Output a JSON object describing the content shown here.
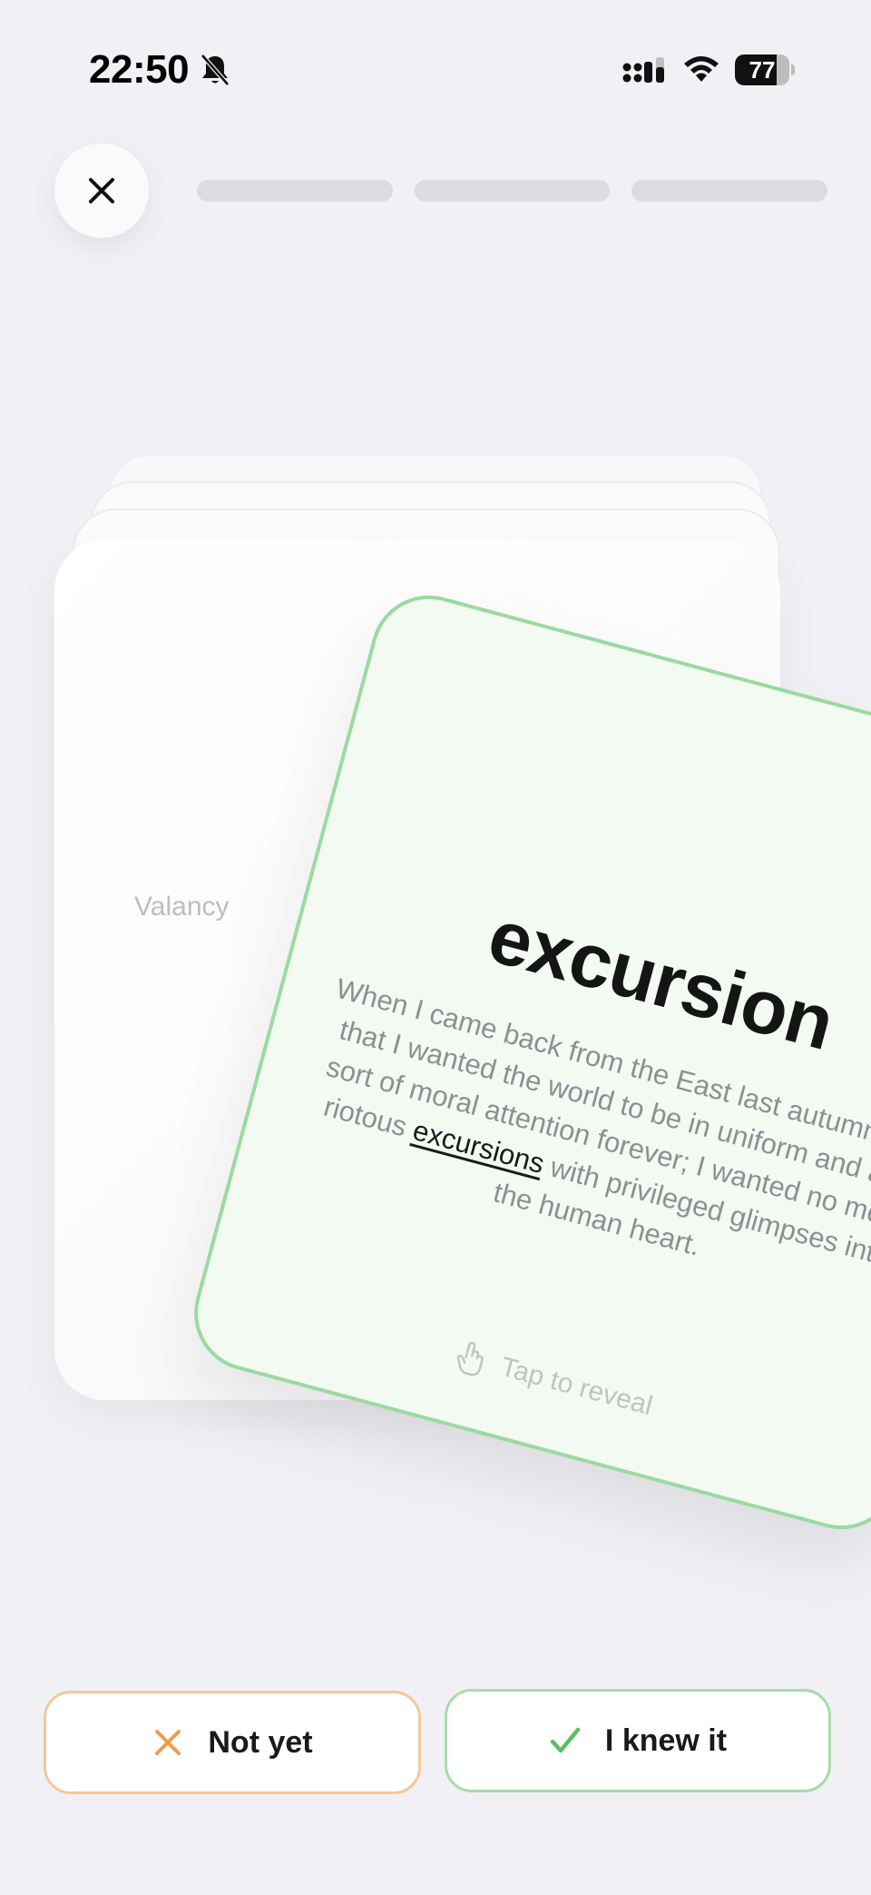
{
  "status_bar": {
    "time": "22:50",
    "battery_level": "77",
    "battery_fraction": 0.77,
    "icons": [
      "bell-muted-icon",
      "signal-icon",
      "wifi-icon",
      "battery-icon"
    ]
  },
  "top_bar": {
    "close_icon": "close-icon",
    "progress_segments": 3
  },
  "back_card": {
    "word_partial": "Valancy"
  },
  "card": {
    "word": "excursion",
    "sentence_before": "When I came back from the East last autumn I felt that I wanted the world to be in uniform and at a sort of moral attention forever; I wanted no more riotous ",
    "sentence_highlight": "excursions",
    "sentence_after": " with privileged glimpses into the human heart.",
    "reveal_hint": "Tap to reveal",
    "reveal_icon": "hand-tap-icon",
    "border_color": "#9cd9a0",
    "background_color": "#f2faf2"
  },
  "actions": {
    "not_yet_label": "Not yet",
    "not_yet_icon": "x-icon",
    "not_yet_color": "#f29a4a",
    "knew_label": "I knew it",
    "knew_icon": "check-icon",
    "knew_color": "#5cbf63"
  }
}
